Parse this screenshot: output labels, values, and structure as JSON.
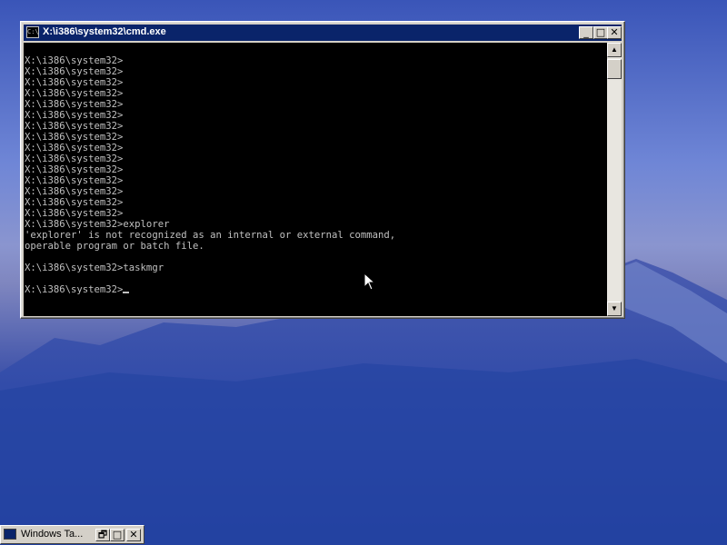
{
  "window": {
    "title": "X:\\i386\\system32\\cmd.exe",
    "icon": "cmd-icon",
    "minimize_glyph": "_",
    "maximize_glyph": "□",
    "close_glyph": "✕"
  },
  "console": {
    "lines": [
      "",
      "X:\\i386\\system32>",
      "X:\\i386\\system32>",
      "X:\\i386\\system32>",
      "X:\\i386\\system32>",
      "X:\\i386\\system32>",
      "X:\\i386\\system32>",
      "X:\\i386\\system32>",
      "X:\\i386\\system32>",
      "X:\\i386\\system32>",
      "X:\\i386\\system32>",
      "X:\\i386\\system32>",
      "X:\\i386\\system32>",
      "X:\\i386\\system32>",
      "X:\\i386\\system32>",
      "X:\\i386\\system32>",
      "X:\\i386\\system32>explorer",
      "'explorer' is not recognized as an internal or external command,",
      "operable program or batch file.",
      "",
      "X:\\i386\\system32>taskmgr",
      "",
      "X:\\i386\\system32>"
    ],
    "prompt": "X:\\i386\\system32>"
  },
  "scrollbar": {
    "up_glyph": "▲",
    "down_glyph": "▼"
  },
  "taskbar": {
    "item_label": "Windows Ta...",
    "restore_glyph": "🗗",
    "maximize_glyph": "□",
    "close_glyph": "✕"
  }
}
